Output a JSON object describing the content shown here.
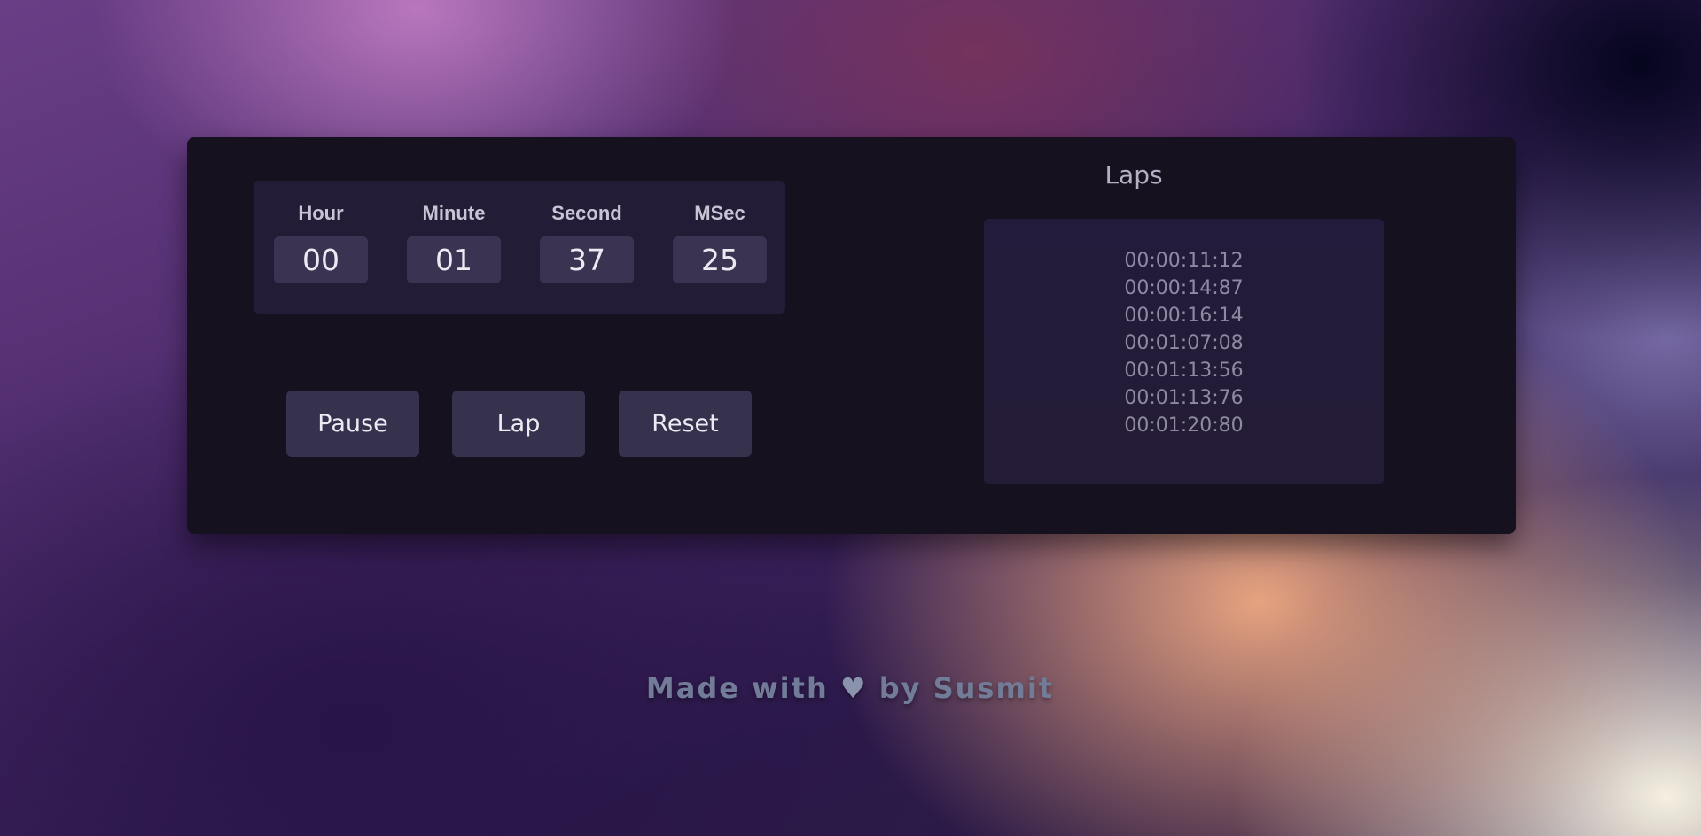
{
  "timer": {
    "units": [
      {
        "label": "Hour",
        "value": "00"
      },
      {
        "label": "Minute",
        "value": "01"
      },
      {
        "label": "Second",
        "value": "37"
      },
      {
        "label": "MSec",
        "value": "25"
      }
    ]
  },
  "controls": {
    "pause_label": "Pause",
    "lap_label": "Lap",
    "reset_label": "Reset"
  },
  "laps": {
    "title": "Laps",
    "items": [
      "00:00:11:12",
      "00:00:14:87",
      "00:00:16:14",
      "00:01:07:08",
      "00:01:13:56",
      "00:01:13:76",
      "00:01:20:80"
    ]
  },
  "footer": {
    "prefix": "Made with",
    "icon": "heart-icon",
    "suffix": "by Susmit"
  },
  "colors": {
    "card_background": "#15111f",
    "panel_background": "#221c36",
    "button_background": "#36314d",
    "value_background": "#3a3452"
  }
}
